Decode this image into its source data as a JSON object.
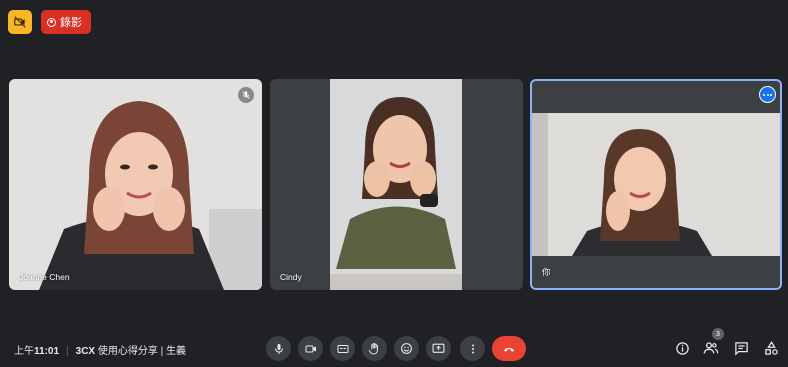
{
  "header": {
    "record_label": "錄影"
  },
  "participants": [
    {
      "name": "Joanne Chen",
      "muted": true
    },
    {
      "name": "Cindy"
    },
    {
      "name": "你",
      "active_speaker_color": "#8ab4f8"
    }
  ],
  "footer": {
    "time_prefix": "上午",
    "time": "11:01",
    "meeting_code": "3CX",
    "meeting_title": "使用心得分享 | 生義",
    "people_count": "3"
  },
  "colors": {
    "background": "#202124",
    "hangup": "#ea4335",
    "record": "#d93025",
    "camera_badge": "#f9b627"
  },
  "icons": {
    "camera_badge": "video-off-icon",
    "record": "record-icon",
    "controls": [
      "mic-icon",
      "camera-icon",
      "captions-icon",
      "raise-hand-icon",
      "emoji-icon",
      "present-icon",
      "more-vert-icon",
      "hangup-icon"
    ],
    "right": [
      "info-icon",
      "people-icon",
      "chat-icon",
      "activities-icon"
    ]
  }
}
